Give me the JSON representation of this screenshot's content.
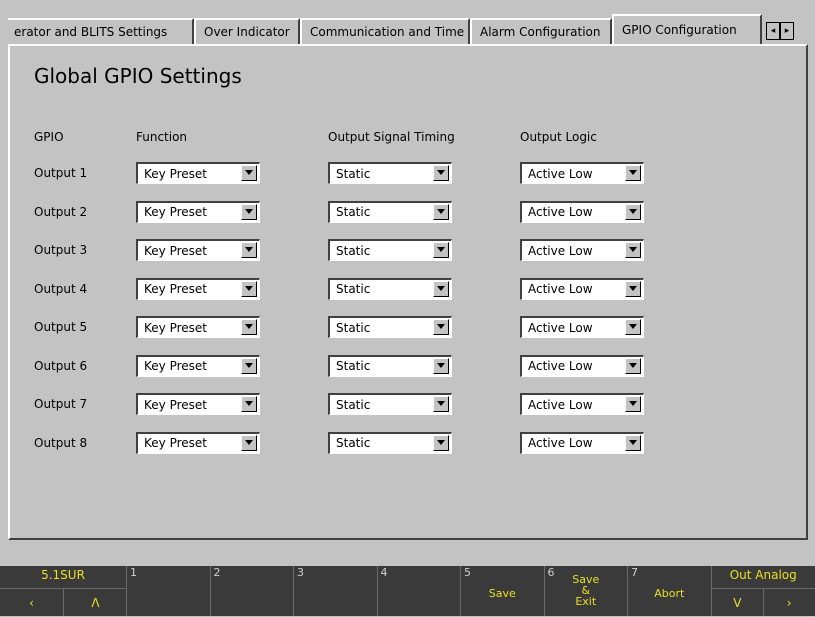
{
  "tabs": [
    {
      "label": "erator and BLITS Settings",
      "active": false
    },
    {
      "label": "Over Indicator",
      "active": false
    },
    {
      "label": "Communication and Time",
      "active": false
    },
    {
      "label": "Alarm Configuration",
      "active": false
    },
    {
      "label": "GPIO Configuration",
      "active": true
    }
  ],
  "tab_scroll": {
    "left": "◂",
    "right": "▸"
  },
  "title": "Global GPIO Settings",
  "columns": {
    "gpio": "GPIO",
    "function": "Function",
    "timing": "Output Signal Timing",
    "logic": "Output Logic"
  },
  "rows": [
    {
      "label": "Output 1",
      "function": "Key Preset",
      "timing": "Static",
      "logic": "Active Low"
    },
    {
      "label": "Output 2",
      "function": "Key Preset",
      "timing": "Static",
      "logic": "Active Low"
    },
    {
      "label": "Output 3",
      "function": "Key Preset",
      "timing": "Static",
      "logic": "Active Low"
    },
    {
      "label": "Output 4",
      "function": "Key Preset",
      "timing": "Static",
      "logic": "Active Low"
    },
    {
      "label": "Output 5",
      "function": "Key Preset",
      "timing": "Static",
      "logic": "Active Low"
    },
    {
      "label": "Output 6",
      "function": "Key Preset",
      "timing": "Static",
      "logic": "Active Low"
    },
    {
      "label": "Output 7",
      "function": "Key Preset",
      "timing": "Static",
      "logic": "Active Low"
    },
    {
      "label": "Output 8",
      "function": "Key Preset",
      "timing": "Static",
      "logic": "Active Low"
    }
  ],
  "footer": {
    "left": {
      "top": "5.1SUR",
      "prev": "‹",
      "up": "Λ"
    },
    "keys": [
      {
        "num": "1",
        "label": ""
      },
      {
        "num": "2",
        "label": ""
      },
      {
        "num": "3",
        "label": ""
      },
      {
        "num": "4",
        "label": ""
      },
      {
        "num": "5",
        "label": "Save"
      },
      {
        "num": "6",
        "label": "Save\n&\nExit"
      },
      {
        "num": "7",
        "label": "Abort"
      }
    ],
    "right": {
      "top": "Out Analog",
      "down": "V",
      "next": "›"
    },
    "accent_color": "#e8e020"
  }
}
